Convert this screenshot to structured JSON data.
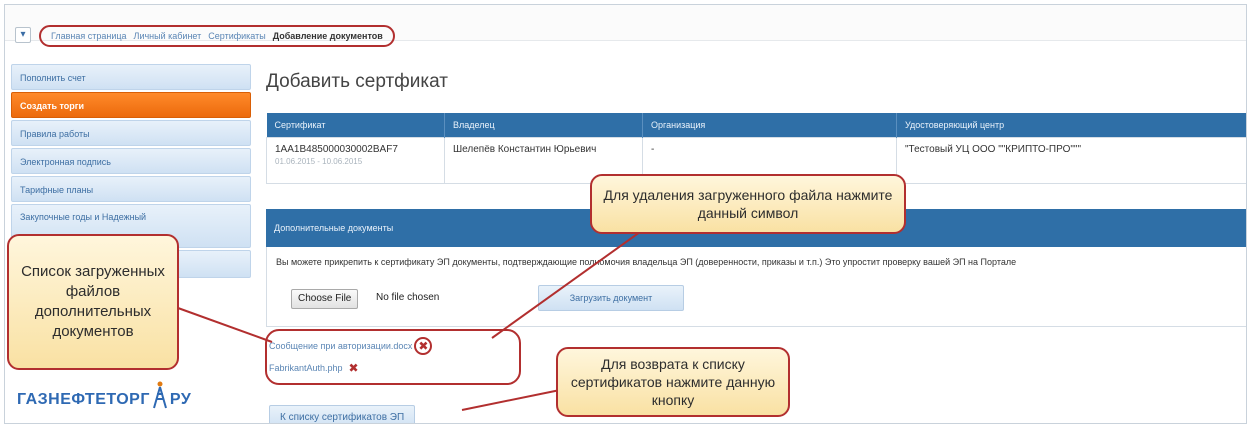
{
  "breadcrumb": {
    "items": [
      "Главная страница",
      "Личный кабинет",
      "Сертификаты"
    ],
    "current": "Добавление документов"
  },
  "sidebar": {
    "items": [
      {
        "label": "Пополнить счет"
      },
      {
        "label": "Создать торги"
      },
      {
        "label": "Правила работы"
      },
      {
        "label": "Электронная подпись"
      },
      {
        "label": "Тарифные планы"
      },
      {
        "label": "Закупочные годы и Надежный"
      }
    ],
    "active_index": 1
  },
  "logo": {
    "text": "ГАЗНЕФТЕТОРГ",
    "suffix": "РУ"
  },
  "main": {
    "title": "Добавить сертфикат",
    "table": {
      "headers": [
        "Сертификат",
        "Владелец",
        "Организация",
        "Удостоверяющий центр"
      ],
      "row": {
        "cert_id": "1AA1B485000030002BAF7",
        "cert_dates": "01.06.2015 - 10.06.2015",
        "owner": "Шелепёв Константин Юрьевич",
        "organization": "-",
        "ca": "\"Тестовый УЦ ООО \"\"КРИПТО-ПРО\"\"\""
      }
    },
    "docs": {
      "header": "Дополнительные документы",
      "info": "Вы можете прикрепить к сертификату ЭП документы, подтверждающие полномочия владельца ЭП (доверенности, приказы и т.п.) Это упростит проверку вашей ЭП на Портале",
      "choose_label": "Choose File",
      "no_file_label": "No file chosen",
      "upload_label": "Загрузить документ",
      "files": [
        {
          "name": "Сообщение при авторизации.docx"
        },
        {
          "name": "FabrikantAuth.php"
        }
      ]
    },
    "back_label": "К списку сертификатов ЭП"
  },
  "callouts": {
    "files_list": "Список загруженных файлов дополнительных документов",
    "delete_hint": "Для удаления загруженного файла нажмите данный символ",
    "back_hint": "Для возврата к списку сертификатов нажмите данную кнопку"
  },
  "colors": {
    "accent": "#2f6fa7",
    "active": "#ec6a0c",
    "highlight": "#b22f2f",
    "callout_fill": "#fbe9b7"
  },
  "icons": {
    "filter": "filter-icon",
    "delete": "close-x-icon",
    "logo_tower": "derrick-icon"
  }
}
